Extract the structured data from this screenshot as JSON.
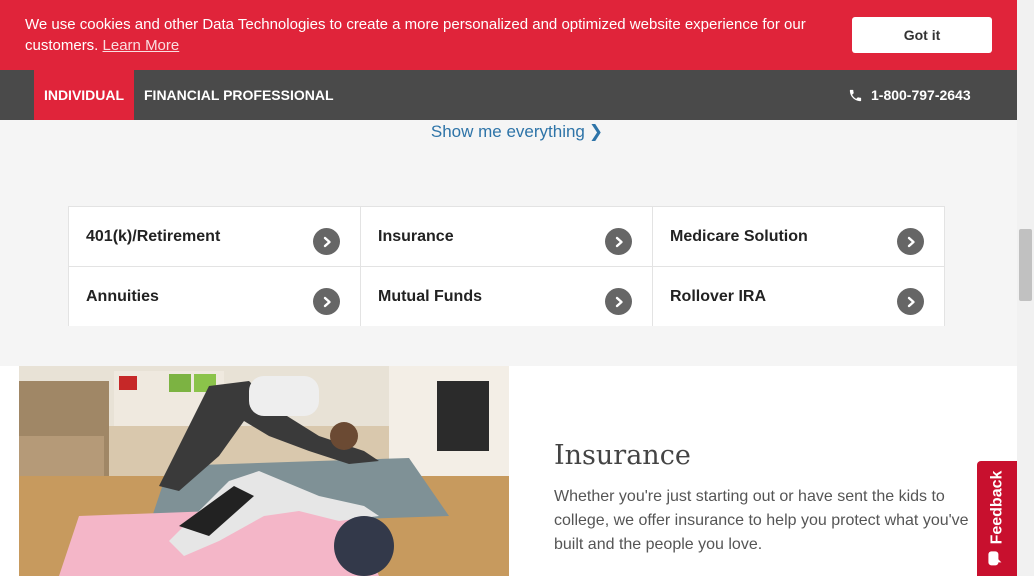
{
  "cookie_banner": {
    "text": "We use cookies and other Data Technologies to create a more personalized and optimized website experience for our customers.",
    "link": "Learn More",
    "button": "Got it"
  },
  "nav": {
    "individual": "INDIVIDUAL",
    "financial_professional": "FINANCIAL PROFESSIONAL",
    "phone": "1-800-797-2643",
    "phone_icon": "phone-icon"
  },
  "show_all": {
    "label": "Show me everything",
    "icon": "chevron-right-icon"
  },
  "categories": [
    {
      "label": "401(k)/Retirement"
    },
    {
      "label": "Insurance"
    },
    {
      "label": "Medicare Solution"
    },
    {
      "label": "Annuities"
    },
    {
      "label": "Mutual Funds"
    },
    {
      "label": "Rollover IRA"
    }
  ],
  "insurance_section": {
    "title": "Insurance",
    "description": "Whether you're just starting out or have sent the kids to college, we offer insurance to help you protect what you've built and the people you love."
  },
  "feedback": {
    "label": "Feedback",
    "icon": "chat-icon"
  },
  "colors": {
    "brand_red": "#e0243a",
    "nav_gray": "#4a4a4a",
    "link_blue": "#2e74a8"
  }
}
